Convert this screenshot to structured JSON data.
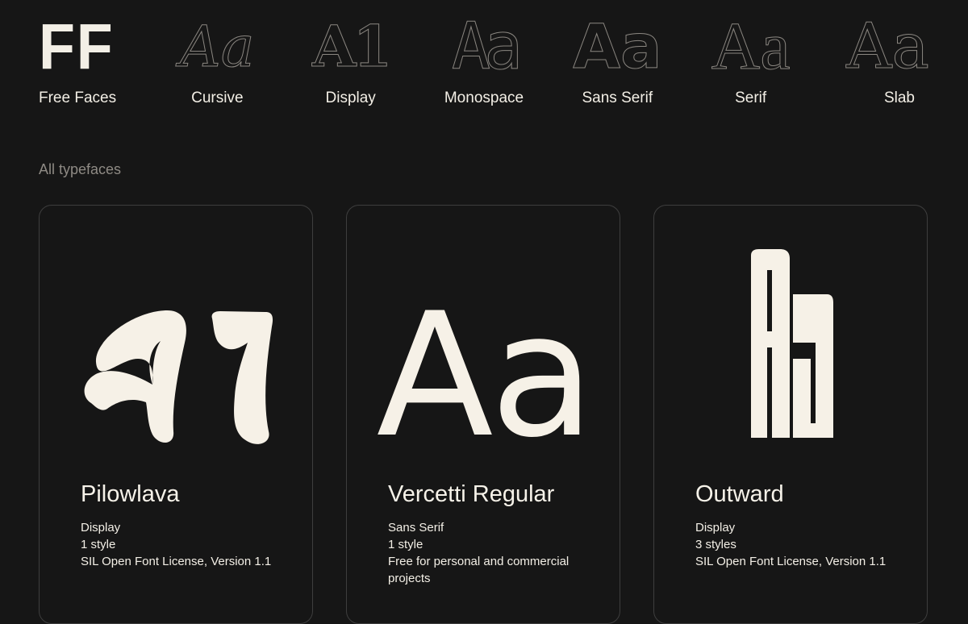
{
  "categories": [
    {
      "label": "Free Faces",
      "glyph": "FF",
      "icon": "ff-logo-icon"
    },
    {
      "label": "Cursive",
      "glyph": "Aa",
      "icon": "cursive-sample-icon"
    },
    {
      "label": "Display",
      "glyph": "A1",
      "icon": "display-sample-icon"
    },
    {
      "label": "Monospace",
      "glyph": "Aa",
      "icon": "monospace-sample-icon"
    },
    {
      "label": "Sans Serif",
      "glyph": "Aa",
      "icon": "sans-serif-sample-icon"
    },
    {
      "label": "Serif",
      "glyph": "Aa",
      "icon": "serif-sample-icon"
    },
    {
      "label": "Slab",
      "glyph": "Aa",
      "icon": "slab-sample-icon"
    }
  ],
  "section": {
    "title": "All typefaces"
  },
  "typefaces": [
    {
      "name": "Pilowlava",
      "category": "Display",
      "styles": "1 style",
      "license": "SIL Open Font License, Version 1.1",
      "preview": "A1"
    },
    {
      "name": "Vercetti Regular",
      "category": "Sans Serif",
      "styles": "1 style",
      "license": "Free for personal and commercial projects",
      "preview": "Aa"
    },
    {
      "name": "Outward",
      "category": "Display",
      "styles": "3 styles",
      "license": "SIL Open Font License, Version 1.1",
      "preview": "Aa"
    }
  ],
  "colors": {
    "background": "#161616",
    "text": "#f3efe6",
    "muted": "#8e8a84",
    "outline": "#8a8680",
    "card_border": "#3e3e3e"
  }
}
